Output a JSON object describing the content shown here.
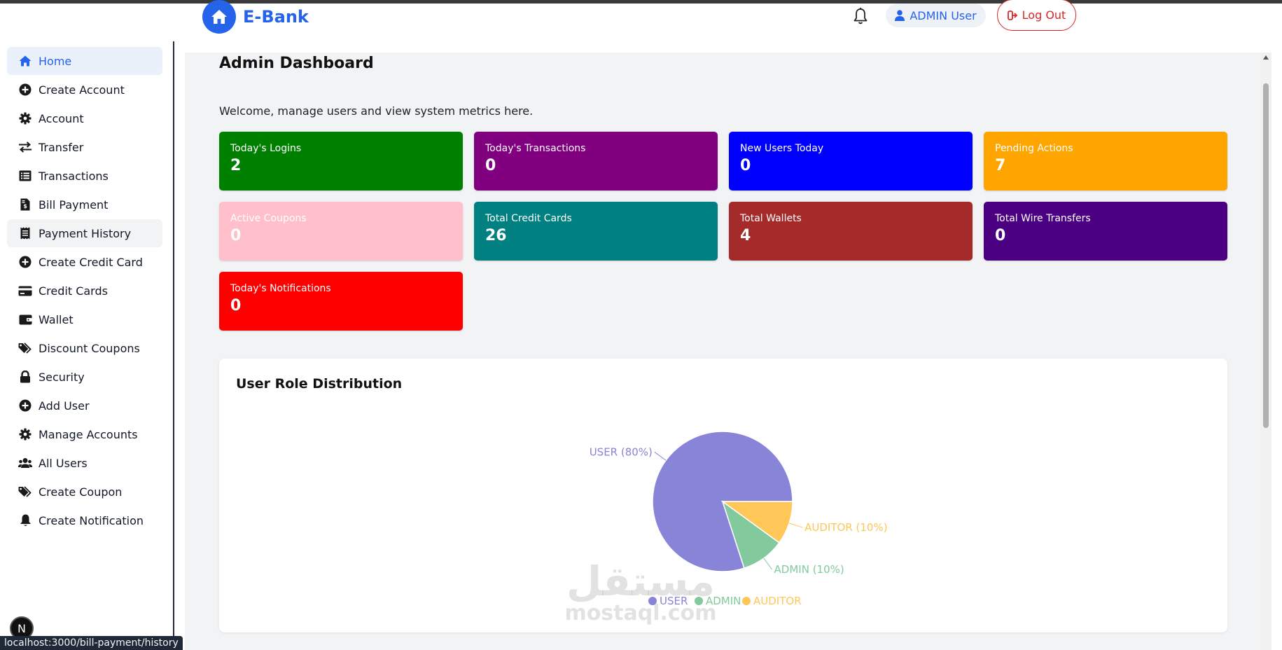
{
  "brand": {
    "name": "E-Bank"
  },
  "header": {
    "user_label": "ADMIN User",
    "logout_label": "Log Out"
  },
  "sidebar": {
    "items": [
      {
        "label": "Home",
        "icon": "home-icon",
        "active": true
      },
      {
        "label": "Create Account",
        "icon": "plus-circle-icon"
      },
      {
        "label": "Account",
        "icon": "gear-icon"
      },
      {
        "label": "Transfer",
        "icon": "exchange-icon"
      },
      {
        "label": "Transactions",
        "icon": "list-icon"
      },
      {
        "label": "Bill Payment",
        "icon": "invoice-icon"
      },
      {
        "label": "Payment History",
        "icon": "receipt-icon",
        "hover": true
      },
      {
        "label": "Create Credit Card",
        "icon": "plus-circle-icon"
      },
      {
        "label": "Credit Cards",
        "icon": "credit-card-icon"
      },
      {
        "label": "Wallet",
        "icon": "wallet-icon"
      },
      {
        "label": "Discount Coupons",
        "icon": "tags-icon"
      },
      {
        "label": "Security",
        "icon": "lock-icon"
      },
      {
        "label": "Add User",
        "icon": "plus-circle-icon"
      },
      {
        "label": "Manage Accounts",
        "icon": "gear-icon"
      },
      {
        "label": "All Users",
        "icon": "users-icon"
      },
      {
        "label": "Create Coupon",
        "icon": "tags-icon"
      },
      {
        "label": "Create Notification",
        "icon": "bell-icon"
      }
    ]
  },
  "main": {
    "title": "Admin Dashboard",
    "welcome": "Welcome, manage users and view system metrics here.",
    "cards": [
      {
        "label": "Today's Logins",
        "value": "2",
        "color": "#008000"
      },
      {
        "label": "Today's Transactions",
        "value": "0",
        "color": "#800080"
      },
      {
        "label": "New Users Today",
        "value": "0",
        "color": "#0000ff"
      },
      {
        "label": "Pending Actions",
        "value": "7",
        "color": "#ffa500"
      },
      {
        "label": "Active Coupons",
        "value": "0",
        "color": "#ffc0cb"
      },
      {
        "label": "Total Credit Cards",
        "value": "26",
        "color": "#008080"
      },
      {
        "label": "Total Wallets",
        "value": "4",
        "color": "#a52a2a"
      },
      {
        "label": "Total Wire Transfers",
        "value": "0",
        "color": "#4b0082"
      },
      {
        "label": "Today's Notifications",
        "value": "0",
        "color": "#ff0000"
      }
    ]
  },
  "chart_data": {
    "type": "pie",
    "title": "User Role Distribution",
    "categories": [
      "USER",
      "ADMIN",
      "AUDITOR"
    ],
    "values": [
      80,
      10,
      10
    ],
    "slice_labels": [
      "USER (80%)",
      "ADMIN (10%)",
      "AUDITOR (10%)"
    ],
    "colors": [
      "#8884d8",
      "#82ca9d",
      "#ffc658"
    ],
    "legend": "bottom"
  },
  "watermark": {
    "arabic": "مستقل",
    "latin": "mostaql.com"
  },
  "status_bar": {
    "url": "localhost:3000/bill-payment/history"
  },
  "dev_badge": {
    "letter": "N"
  }
}
